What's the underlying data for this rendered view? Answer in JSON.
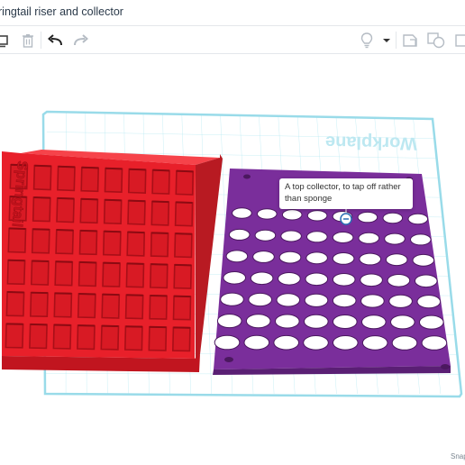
{
  "window": {
    "title": "ringtail riser and collector"
  },
  "toolbar": {
    "copy_icon": "copy-icon",
    "delete_icon": "trash-icon",
    "undo_icon": "undo-arrow-icon",
    "redo_icon": "redo-arrow-icon",
    "light_icon": "lightbulb-icon",
    "dropdown_icon": "chevron-down-icon",
    "shape_icon": "shape-note-icon",
    "group_icon": "group-shapes-icon"
  },
  "workplane": {
    "label": "Workplane",
    "grid_color": "#a6e4f0"
  },
  "objects": {
    "red_riser": {
      "color": "#e8202a",
      "engraved_text": "Springtail"
    },
    "purple_collector": {
      "color": "#7a2e9b"
    }
  },
  "tooltip": {
    "text": "A top collector, to tap off rather than sponge"
  },
  "status": {
    "snap_label": "Snap"
  }
}
